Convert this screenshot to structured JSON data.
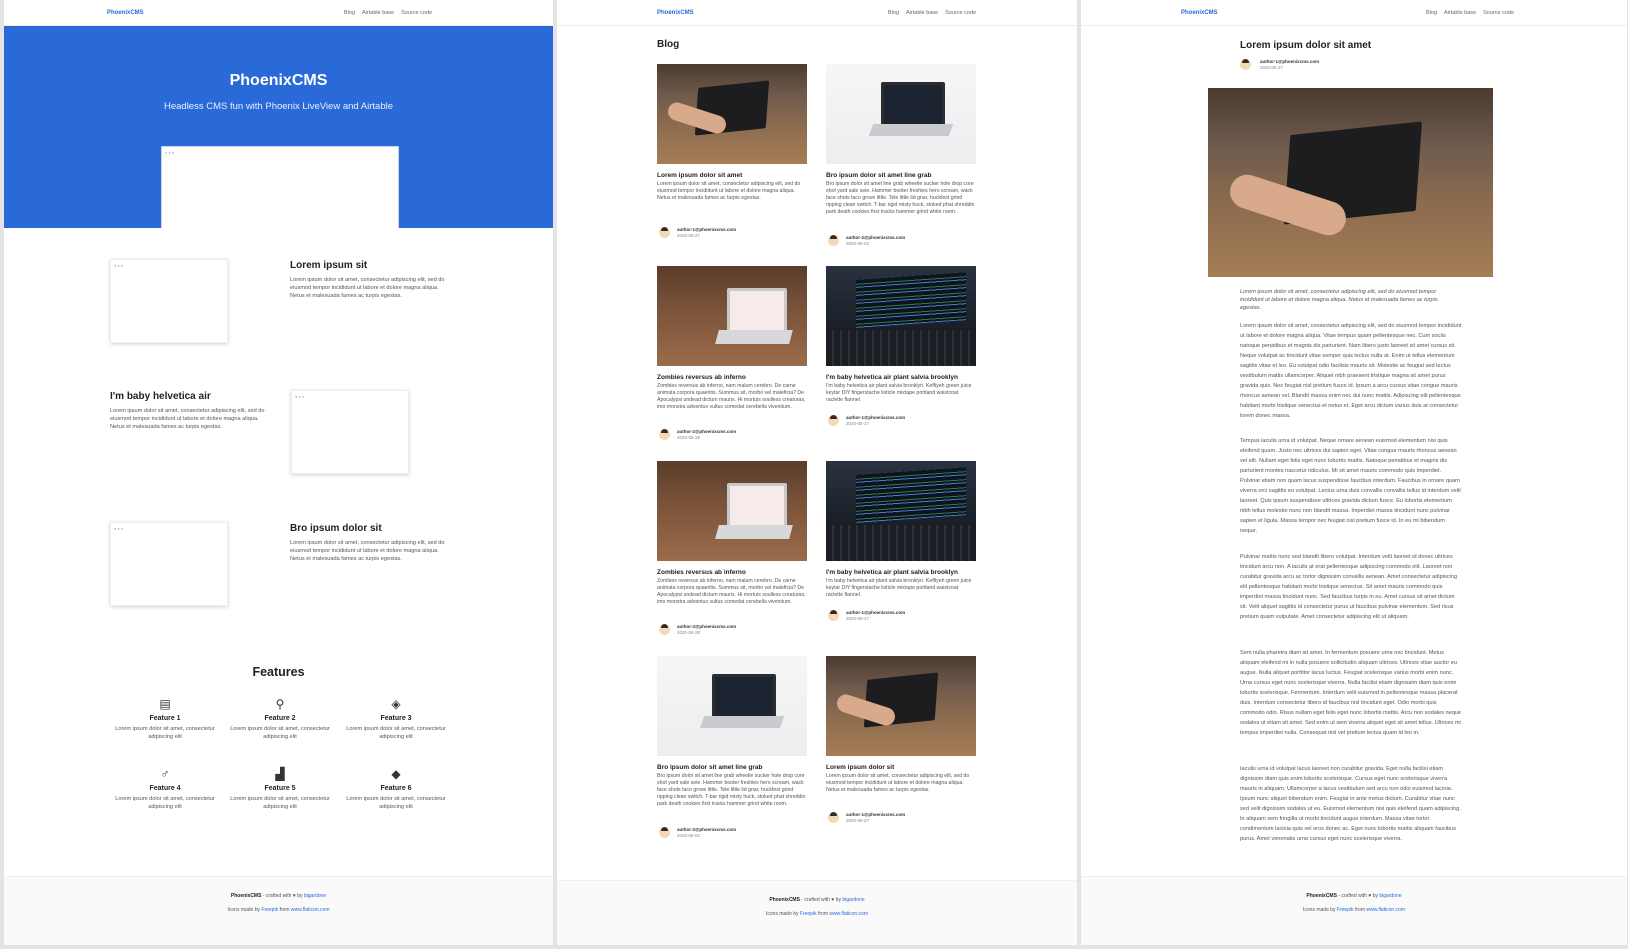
{
  "nav": {
    "brand": "PhoenixCMS",
    "links": [
      "Blog",
      "Airtable base",
      "Source code"
    ]
  },
  "home": {
    "hero_title": "PhoenixCMS",
    "hero_subtitle": "Headless CMS fun with Phoenix LiveView and Airtable",
    "sections": [
      {
        "title": "Lorem ipsum sit",
        "body": "Lorem ipsum dolor sit amet, consectetur adipiscing elit, sed do eiusmod tempor incididunt ut labore et dolore magna aliqua. Netus et malesuada fames ac turpis egestas."
      },
      {
        "title": "I'm baby helvetica air",
        "body": "Lorem ipsum dolor sit amet, consectetur adipiscing elit, sed do eiusmod tempor incididunt ut labore et dolore magna aliqua. Netus et malesuada fames ac turpis egestas."
      },
      {
        "title": "Bro ipsum dolor sit",
        "body": "Lorem ipsum dolor sit amet, consectetur adipiscing elit, sed do eiusmod tempor incididunt ut labore et dolore magna aliqua. Netus et malesuada fames ac turpis egestas."
      }
    ],
    "features_title": "Features",
    "features": [
      {
        "name": "Feature 1",
        "desc": "Lorem ipsum dolor sit amet, consectetur adipiscing elit",
        "icon": "newspaper-icon"
      },
      {
        "name": "Feature 2",
        "desc": "Lorem ipsum dolor sit amet, consectetur adipiscing elit",
        "icon": "bicycle-icon"
      },
      {
        "name": "Feature 3",
        "desc": "Lorem ipsum dolor sit amet, consectetur adipiscing elit",
        "icon": "diamond-icon"
      },
      {
        "name": "Feature 4",
        "desc": "Lorem ipsum dolor sit amet, consectetur adipiscing elit",
        "icon": "scooter-icon"
      },
      {
        "name": "Feature 5",
        "desc": "Lorem ipsum dolor sit amet, consectetur adipiscing elit",
        "icon": "sneaker-icon"
      },
      {
        "name": "Feature 6",
        "desc": "Lorem ipsum dolor sit amet, consectetur adipiscing elit",
        "icon": "tag-icon"
      }
    ]
  },
  "footer": {
    "brand": "PhoenixCMS",
    "crafted": " - crafted with ♥ by ",
    "author_link": "bigardone",
    "icons_prefix": "Icons made by ",
    "freepik": "Freepik",
    "from": " from ",
    "flaticon": "www.flaticon.com"
  },
  "blog": {
    "title": "Blog",
    "cards": [
      {
        "title": "Lorem ipsum dolor sit amet",
        "excerpt": "Lorem ipsum dolor sit amet, consectetur adipiscing elit, sed do eiusmod tempor incididunt ut labore et dolore magna aliqua. Netus et malesuada fames ac turpis egestas.",
        "author": "author-1@phoenixcms.com",
        "date": "2020-06-27",
        "image": "typing"
      },
      {
        "title": "Bro ipsum dolor sit amet line grab",
        "excerpt": "Bro ipsum dolor sit amet line grab wheelie sucker hole drop core shot yard sale avie. Hammer booter freshies hero scream, wack face shots taco grove little. Tele little lid gnar, huckfest grind ripping clean switch. T-bar rigid misty huck, stoked phat shreddin park death cookies first tracks hammer grind white room.",
        "author": "author-2@phoenixcms.com",
        "date": "2020-06-02",
        "image": "white"
      },
      {
        "title": "Zombies reversus ab inferno",
        "excerpt": "Zombies reversus ab inferno, nam malum cerebro. De carne animata corpora quaeritis. Summus sit, morbo vel maleficia? De Apocalypsi undead dictum mauris. Hi mortuis soulless creaturas, imo monstra adventus vultus comedat cerebella viventium.",
        "author": "author-2@phoenixcms.com",
        "date": "2020-06-28",
        "image": "desk"
      },
      {
        "title": "I'm baby helvetica air plant salvia brooklyn",
        "excerpt": "I'm baby helvetica air plant salvia brooklyn. Keffiyeh green juice keytar DIY fingerstache listicle mixtape portland waistcoat raclette flannel.",
        "author": "author-1@phoenixcms.com",
        "date": "2020-06-17",
        "image": "code"
      },
      {
        "title": "Zombies reversus ab inferno",
        "excerpt": "Zombies reversus ab inferno, nam malum cerebro. De carne animata corpora quaeritis. Summus sit, morbo vel maleficia? De Apocalypsi undead dictum mauris. Hi mortuis soulless creaturas, imo monstra adventus vultus comedat cerebella viventium.",
        "author": "author-2@phoenixcms.com",
        "date": "2020-06-28",
        "image": "desk"
      },
      {
        "title": "I'm baby helvetica air plant salvia brooklyn",
        "excerpt": "I'm baby helvetica air plant salvia brooklyn. Keffiyeh green juice keytar DIY fingerstache listicle mixtape portland waistcoat raclette flannel.",
        "author": "author-1@phoenixcms.com",
        "date": "2020-06-17",
        "image": "code"
      },
      {
        "title": "Bro ipsum dolor sit amet line grab",
        "excerpt": "Bro ipsum dolor sit amet line grab wheelie sucker hole drop core shot yard sale avie. Hammer booter freshies hero scream, wack face shots taco grove little. Tele little lid gnar, huckfest grind ripping clean switch. T-bar rigid misty huck, stoked phat shreddin park death cookies first tracks hammer grind white room.",
        "author": "author-2@phoenixcms.com",
        "date": "2020-06-02",
        "image": "white"
      },
      {
        "title": "Lorem ipsum dolor sit",
        "excerpt": "Lorem ipsum dolor sit amet, consectetur adipiscing elit, sed do eiusmod tempor incididunt ut labore et dolore magna aliqua. Netus et malesuada fames ac turpis egestas.",
        "author": "author-1@phoenixcms.com",
        "date": "2020-06-27",
        "image": "typing"
      }
    ]
  },
  "article": {
    "title": "Lorem ipsum dolor sit amet",
    "author": "author-1@phoenixcms.com",
    "date": "2020-06-27",
    "lead": "Lorem ipsum dolor sit amet, consectetur adipiscing elit, sed do eiusmod tempor incididunt ut labore et dolore magna aliqua. Netus et malesuada fames ac turpis egestas.",
    "paragraphs": [
      "Lorem ipsum dolor sit amet, consectetur adipiscing elit, sed do eiusmod tempor incididunt ut labore et dolore magna aliqua. Vitae tempus quam pellentesque nec. Cum sociis natoque penatibus et magnis dis parturient. Nam libero justo laoreet sit amet cursus sit. Neque volutpat ac tincidunt vitae semper quis lectus nulla at. Enim ut tellus elementum sagittis vitae et leo. Eu volutpat odio facilisis mauris sit. Molestie ac feugiat sed lectus vestibulum mattis ullamcorper. Aliquet nibh praesent tristique magna sit amet purus gravida quis. Nec feugiat nisl pretium fusce id. Ipsum a arcu cursus vitae congue mauris rhoncus aenean vel. Blandit massa enim nec dui nunc mattis. Adipiscing elit pellentesque habitant morbi tristique senectus et netus et. Eget arcu dictum varius duis at consectetur lorem donec massa.",
      "Tempus iaculis urna id volutpat. Neque ornare aenean euismod elementum nisi quis eleifend quam. Justo nec ultrices dui sapien eget. Vitae congue mauris rhoncus aenean vel elit. Nullam eget felis eget nunc lobortis mattis. Natoque penatibus et magnis dis parturient montes nascetur ridiculus. Mi sit amet mauris commodo quis imperdiet. Pulvinar etiam non quam lacus suspendisse faucibus interdum. Faucibus in ornare quam viverra orci sagittis eu volutpat. Lectus urna duis convallis convallis tellus id interdum velit laoreet. Quis ipsum suspendisse ultrices gravida dictum fusce. Eu lobortis elementum nibh tellus molestie nunc non blandit massa. Imperdiet massa tincidunt nunc pulvinar sapien et ligula. Massa tempor nec feugiat nisl pretium fusce id. In eu mi bibendum neque.",
      "Pulvinar mattis nunc sed blandit libero volutpat. Interdum velit laoreet id donec ultrices tincidunt arcu non. A iaculis at erat pellentesque adipiscing commodo elit. Laoreet non curabitur gravida arcu ac tortor dignissim convallis aenean. Amet consectetur adipiscing elit pellentesque habitant morbi tristique senectus. Sit amet mauris commodo quis imperdiet massa tincidunt nunc. Sed faucibus turpis in eu. Amet cursus sit amet dictum sit. Velit aliquet sagittis id consectetur purus ut faucibus pulvinar elementum. Sed risus pretium quam vulputate. Amet consectetur adipiscing elit ut aliquam.",
      "Sem nulla pharetra diam sit amet. In fermentum posuere urna nec tincidunt. Metus aliquam eleifend mi in nulla posuere sollicitudin aliquam ultrices. Ultrices vitae auctor eu augue. Nulla aliquet porttitor lacus luctus. Feugiat scelerisque varius morbi enim nunc. Urna cursus eget nunc scelerisque viverra. Nulla facilisi etiam dignissim diam quis enim lobortis scelerisque. Fermentum. Interdum velit euismod in pellentesque massa placerat duis. Interdum consectetur libero id faucibus nisl tincidunt eget. Odio morbi quis commodo odio. Risus nullam eget felis eget nunc lobortis mattis. Arcu non sodales neque sodales ut etiam sit amet. Sed enim ut sem viverra aliquet eget sit amet tellus. Ultrices mi tempus imperdiet nulla. Consequat nisl vel pretium lectus quam id leo in.",
      "Iaculis urna id volutpat lacus laoreet non curabitur gravida. Eget nulla facilisi etiam dignissim diam quis enim lobortis scelerisque. Cursus eget nunc scelerisque viverra mauris in aliquam. Ullamcorper a lacus vestibulum sed arcu non odio euismod lacinia. Ipsum nunc aliquet bibendum enim. Feugiat in ante metus dictum. Curabitur vitae nunc sed velit dignissim sodales ut eu. Euismod elementum nisi quis eleifend quam adipiscing. In aliquam sem fringilla ut morbi tincidunt augue interdum. Massa vitae tortor condimentum lacinia quis vel eros donec ac. Eget nunc lobortis mattis aliquam faucibus purus. Amet venenatis urna cursus eget nunc scelerisque viverra."
    ]
  }
}
